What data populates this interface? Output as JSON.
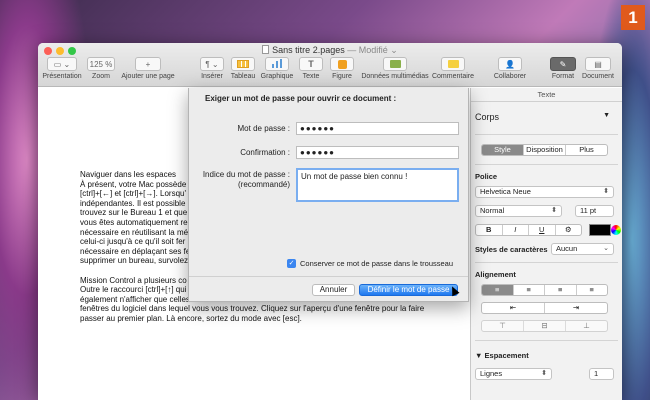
{
  "badge": "1",
  "window": {
    "title": "Sans titre 2.pages",
    "modified": "— Modifié"
  },
  "toolbar": {
    "presentation": "Présentation",
    "zoom_value": "125 %",
    "zoom": "Zoom",
    "add_page": "Ajouter une page",
    "insert": "Insérer",
    "table": "Tableau",
    "chart": "Graphique",
    "text": "Texte",
    "shape": "Figure",
    "media": "Données multimédias",
    "comment": "Commentaire",
    "collaborate": "Collaborer",
    "format": "Format",
    "document": "Document"
  },
  "document": {
    "paragraphs": [
      "Naviguer dans les espaces\nÀ présent, votre Mac possède\n[ctrl]+[←] et [ctrl]+[→]. Lorsqu'\nindépendantes. Il est possible\ntrouvez sur le Bureau 1 et que\nvous êtes automatiquement re\nnécessaire en réutilisant la mét\ncelui-ci jusqu'à ce qu'il soit fer\nnécessaire en déplaçant ses fe\nsupprimer un bureau, survolez",
      "Mission Control a plusieurs co\nOutre le raccourci [ctrl]+[↑] qui\négalement n'afficher que celles\nfenêtres du logiciel dans lequel vous vous trouvez. Cliquez sur l'aperçu d'une fenêtre pour la faire\npasser au premier plan. Là encore, sortez du mode avec [esc]."
    ]
  },
  "dialog": {
    "title": "Exiger un mot de passe pour ouvrir ce document :",
    "password_label": "Mot de passe :",
    "password_value": "●●●●●●",
    "confirm_label": "Confirmation :",
    "confirm_value": "●●●●●●",
    "hint_label": "Indice du mot de passe :\n(recommandé)",
    "hint_value": "Un mot de passe bien connu !",
    "keychain_label": "Conserver ce mot de passe dans le trousseau",
    "cancel": "Annuler",
    "ok": "Définir le mot de passe"
  },
  "inspector": {
    "header": "Texte",
    "style": "Corps",
    "tabs": [
      "Style",
      "Disposition",
      "Plus"
    ],
    "font_label": "Police",
    "font": "Helvetica Neue",
    "weight": "Normal",
    "size": "11 pt",
    "bold": "B",
    "italic": "I",
    "underline": "U",
    "char_styles_label": "Styles de caractères",
    "char_styles_value": "Aucun",
    "alignment_label": "Alignement",
    "spacing_label": "Espacement",
    "spacing_type": "Lignes",
    "spacing_value": "1"
  },
  "colors": {
    "accent": "#1e78f0",
    "badge": "#e05a1c"
  }
}
